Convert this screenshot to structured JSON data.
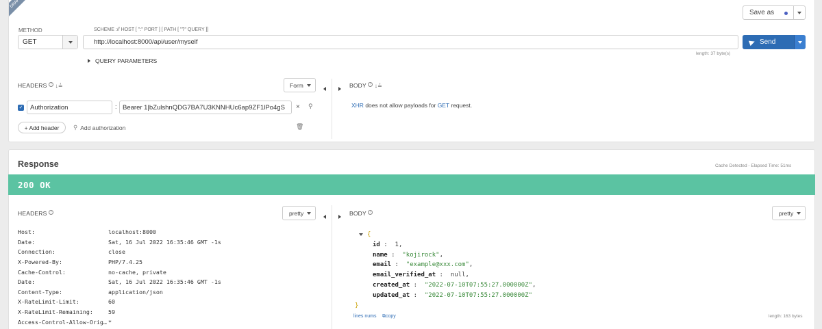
{
  "request": {
    "draft_badge": "DRAFT",
    "save_as_label": "Save as",
    "method_label": "METHOD",
    "method_value": "GET",
    "url_label": "SCHEME :// HOST [ \":\" PORT ] [ PATH [ \"?\" QUERY ]]",
    "url_value": "http://localhost:8000/api/user/myself",
    "url_length": "length: 37 byte(s)",
    "send_label": "Send",
    "query_params_label": "QUERY PARAMETERS",
    "headers_title": "HEADERS",
    "headers_mode": "Form",
    "body_title": "BODY",
    "header_name": "Authorization",
    "header_value": "Bearer 1|bZulshnQDG7BA7U3KNNHUc6ap9ZF1lPo4gS",
    "add_header_label": "+ Add header",
    "add_authorization_label": "Add authorization",
    "body_msg": {
      "part1": "XHR",
      "part2": " does not allow payloads for ",
      "part3": "GET",
      "part4": " request."
    }
  },
  "response": {
    "title": "Response",
    "cache_info": "Cache Detected - Elapsed Time: 51ms",
    "status": "200 OK",
    "status_color": "#5bc3a2",
    "headers_title": "HEADERS",
    "headers_mode": "pretty",
    "body_title": "BODY",
    "body_mode": "pretty",
    "headers": [
      {
        "k": "Host:",
        "v": "localhost:8000"
      },
      {
        "k": "Date:",
        "v": "Sat, 16 Jul 2022 16:35:46 GMT -1s"
      },
      {
        "k": "Connection:",
        "v": "close"
      },
      {
        "k": "X-Powered-By:",
        "v": "PHP/7.4.25"
      },
      {
        "k": "Cache-Control:",
        "v": "no-cache, private"
      },
      {
        "k": "Date:",
        "v": "Sat, 16 Jul 2022 16:35:46 GMT -1s"
      },
      {
        "k": "Content-Type:",
        "v": "application/json"
      },
      {
        "k": "X-RateLimit-Limit:",
        "v": "60"
      },
      {
        "k": "X-RateLimit-Remaining:",
        "v": "59"
      },
      {
        "k": "Access-Control-Allow-Orig…",
        "v": "*"
      }
    ],
    "json": {
      "open": "{",
      "close": "}",
      "id_key": "id",
      "id_val": "1",
      "name_key": "name",
      "name_val": "\"kojirock\"",
      "email_key": "email",
      "email_val": "\"example@xxx.com\"",
      "evat_key": "email_verified_at",
      "evat_val": "null",
      "created_key": "created_at",
      "created_val": "\"2022-07-10T07:55:27.000000Z\"",
      "updated_key": "updated_at",
      "updated_val": "\"2022-07-10T07:55:27.000000Z\""
    },
    "line_nums_label": "lines nums",
    "copy_label": "copy",
    "body_length": "length: 163 bytes"
  },
  "colors": {
    "send_blue": "#2d6cb4",
    "link_blue": "#2f6db5",
    "json_string": "#3a8a3a",
    "status_green": "#5bc3a2"
  }
}
